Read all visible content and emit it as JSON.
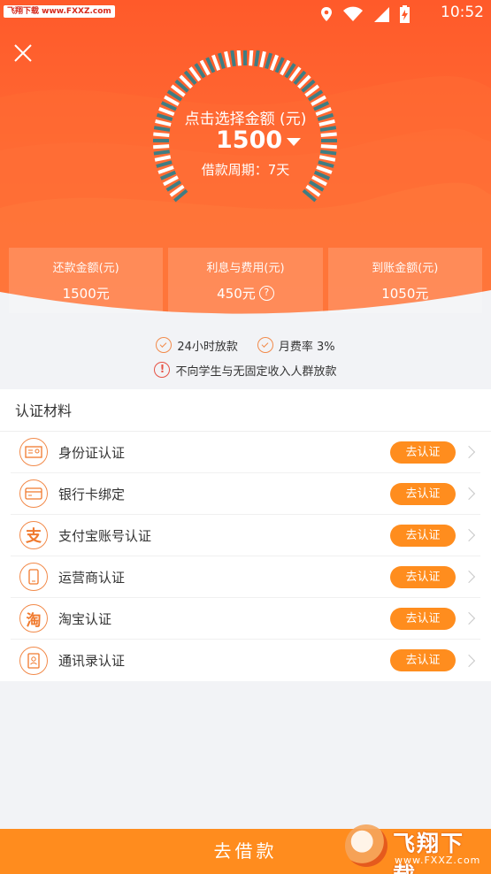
{
  "status_bar": {
    "watermark": "飞翔下载 www.FXXZ.com",
    "time": "10:52",
    "icons": [
      "location-icon",
      "wifi-icon",
      "signal-icon",
      "battery-charging-icon"
    ]
  },
  "header": {
    "close_icon": "close-icon",
    "gauge_title": "点击选择金额 (元)",
    "amount": "1500",
    "period": "借款周期：7天"
  },
  "summary": [
    {
      "label": "还款金额(元)",
      "value": "1500元"
    },
    {
      "label": "利息与费用(元)",
      "value": "450元",
      "info_icon": "?"
    },
    {
      "label": "到账金额(元)",
      "value": "1050元"
    }
  ],
  "notices": {
    "feature_1": "24小时放款",
    "feature_2": "月费率 3%",
    "warning_icon": "!",
    "warning": "不向学生与无固定收入人群放款"
  },
  "auth": {
    "title": "认证材料",
    "items": [
      {
        "label": "身份证认证",
        "icon": "id-card-icon",
        "glyph": "",
        "button": "去认证"
      },
      {
        "label": "银行卡绑定",
        "icon": "bank-card-icon",
        "glyph": "",
        "button": "去认证"
      },
      {
        "label": "支付宝账号认证",
        "icon": "alipay-icon",
        "glyph": "支",
        "button": "去认证"
      },
      {
        "label": "运营商认证",
        "icon": "phone-icon",
        "glyph": "",
        "button": "去认证"
      },
      {
        "label": "淘宝认证",
        "icon": "taobao-icon",
        "glyph": "淘",
        "button": "去认证"
      },
      {
        "label": "通讯录认证",
        "icon": "contacts-icon",
        "glyph": "",
        "button": "去认证"
      }
    ]
  },
  "bottom": {
    "button_label": "去借款",
    "watermark_text": "飞翔下载",
    "watermark_url": "www.FXXZ.com"
  },
  "colors": {
    "header_orange": "#ff5a2a",
    "accent_orange": "#ff8d1e",
    "icon_outline": "#f28a4a",
    "gauge_tick": "#3f7d83"
  }
}
